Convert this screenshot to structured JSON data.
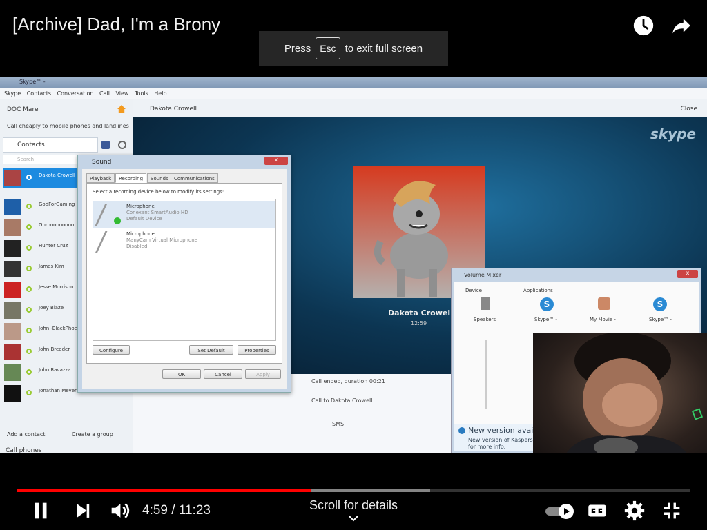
{
  "player": {
    "title": "[Archive] Dad, I'm a Brony",
    "fullscreen_toast": {
      "before": "Press",
      "key": "Esc",
      "after": "to exit full screen"
    },
    "time_current": "4:59",
    "time_separator": " / ",
    "time_total": "11:23",
    "progress_fraction": 0.438,
    "buffered_fraction": 0.614,
    "scroll_hint": "Scroll for details",
    "icons": [
      "watch-later-icon",
      "share-icon",
      "pause-icon",
      "next-icon",
      "volume-icon",
      "autoplay-toggle-icon",
      "captions-icon",
      "settings-icon",
      "exit-fullscreen-icon"
    ]
  },
  "skype": {
    "window_title": "Skype™ - ",
    "menu": [
      "Skype",
      "Contacts",
      "Conversation",
      "Call",
      "View",
      "Tools",
      "Help"
    ],
    "user": "DOC Mare",
    "call_cheaply": "Call cheaply to mobile phones and landlines",
    "contacts_tab": "Contacts",
    "search_placeholder": "Search",
    "contacts": [
      {
        "name": "Dakota Crowell",
        "active": true
      },
      {
        "name": "GodForGaming"
      },
      {
        "name": "Gbrooooooooo"
      },
      {
        "name": "Hunter Cruz"
      },
      {
        "name": "James Kim"
      },
      {
        "name": "Jesse Morrison"
      },
      {
        "name": "Joey Blaze"
      },
      {
        "name": "John -BlackPhoe"
      },
      {
        "name": "John Breeder"
      },
      {
        "name": "John Ravazza"
      },
      {
        "name": "Jonathan Mevers"
      }
    ],
    "add_contact": "Add a contact",
    "create_group": "Create a group",
    "call_phones": "Call phones",
    "conversation_name": "Dakota Crowell",
    "close_label": "Close",
    "logo": "skype",
    "call_name": "Dakota Crowell",
    "call_time": "12:59",
    "call_ended": "Call ended, duration 00:21",
    "call_to": "Call to Dakota Crowell",
    "sms": "SMS"
  },
  "sound_dialog": {
    "title": "Sound",
    "close": "x",
    "tabs": [
      "Playback",
      "Recording",
      "Sounds",
      "Communications"
    ],
    "hint": "Select a recording device below to modify its settings:",
    "devices": [
      {
        "name": "Microphone",
        "line2": "Conexant SmartAudio HD",
        "line3": "Default Device",
        "selected": true
      },
      {
        "name": "Microphone",
        "line2": "ManyCam Virtual Microphone",
        "line3": "Disabled",
        "selected": false
      }
    ],
    "configure": "Configure",
    "set_default": "Set Default",
    "properties": "Properties",
    "ok": "OK",
    "cancel": "Cancel",
    "apply": "Apply"
  },
  "mixer": {
    "title": "Volume Mixer",
    "device_label": "Device",
    "applications_label": "Applications",
    "speakers": "Speakers",
    "apps": [
      "Skype™ -",
      "My Movie -",
      "Skype™ -"
    ],
    "kaspersky_title": "New version available",
    "kaspersky_line1": "New version of Kaspersky",
    "kaspersky_line2": "for more info."
  }
}
